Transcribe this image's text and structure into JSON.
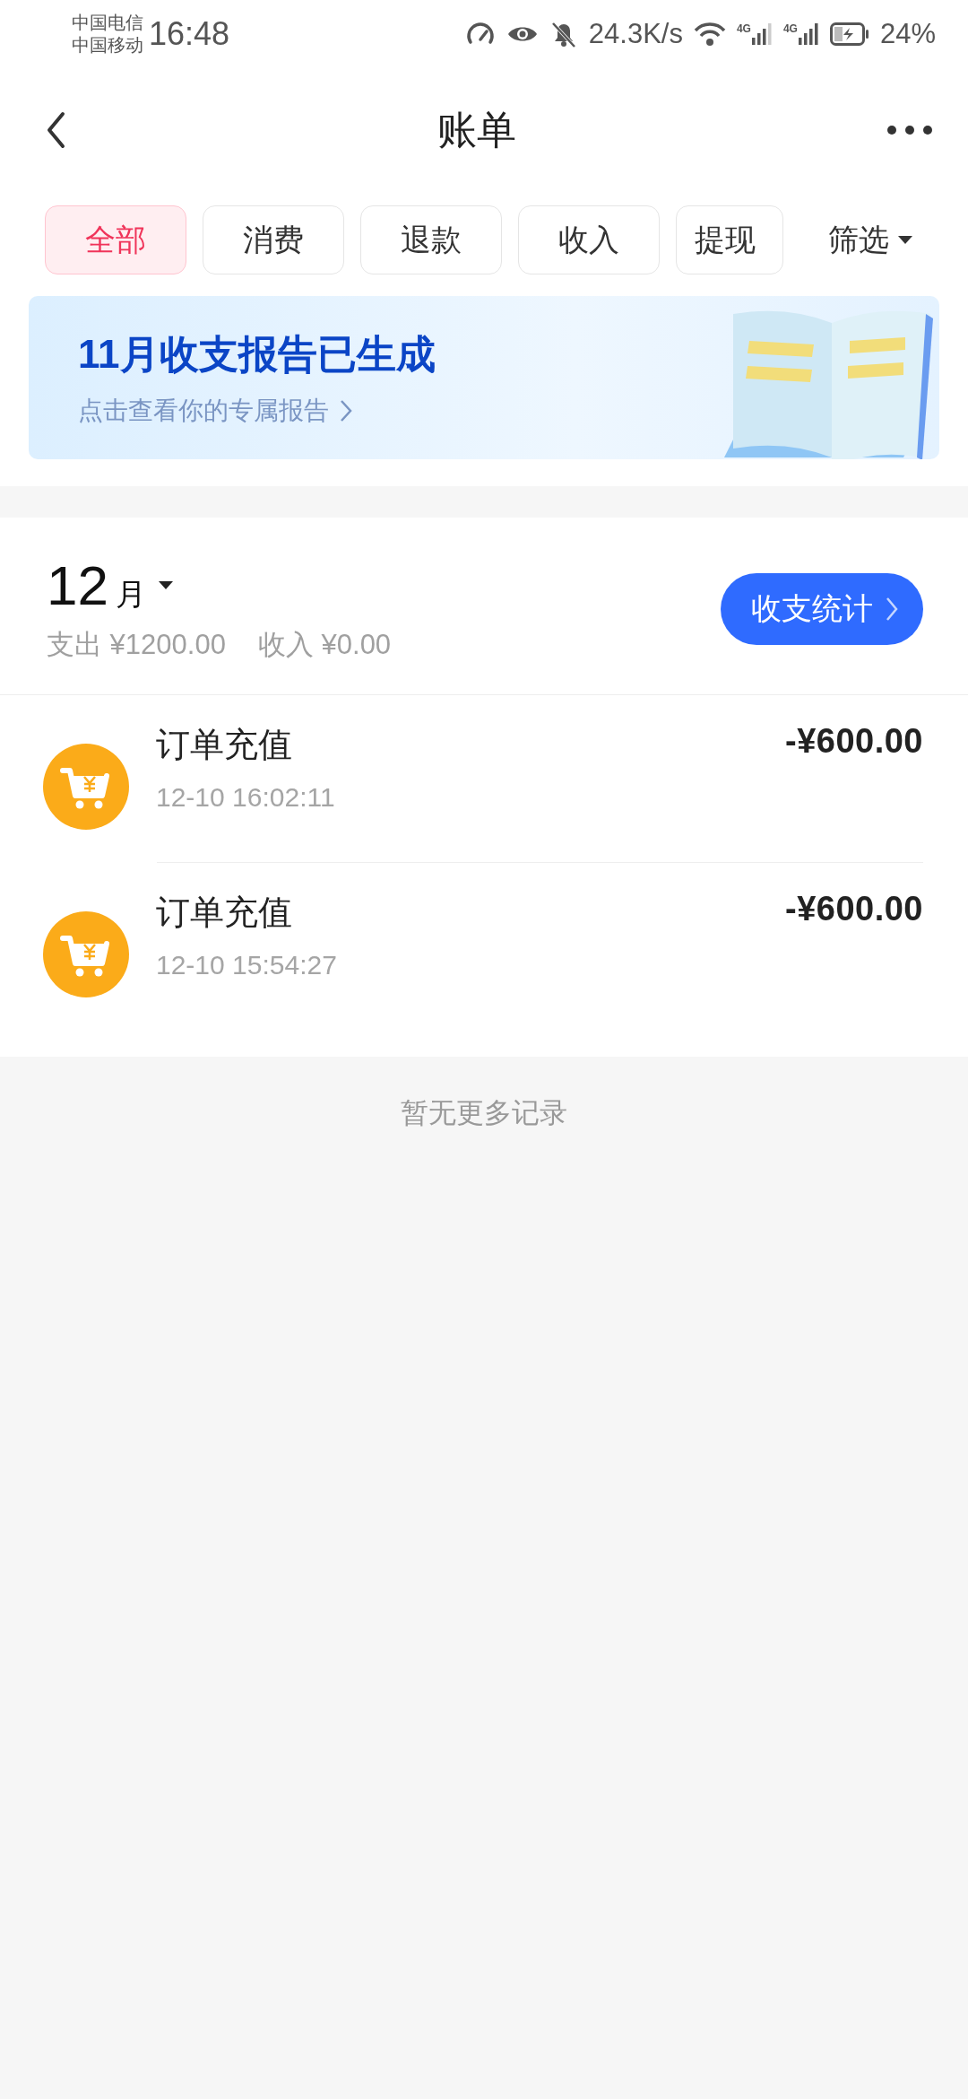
{
  "status_bar": {
    "carriers": [
      "中国电信",
      "中国移动"
    ],
    "time": "16:48",
    "net_speed": "24.3K/s",
    "signal_labels": [
      "4G",
      "4G"
    ],
    "battery": "24%"
  },
  "nav": {
    "title": "账单"
  },
  "tabs": [
    {
      "label": "全部",
      "selected": true
    },
    {
      "label": "消费",
      "selected": false
    },
    {
      "label": "退款",
      "selected": false
    },
    {
      "label": "收入",
      "selected": false
    },
    {
      "label": "提现",
      "selected": false
    }
  ],
  "filter": {
    "label": "筛选"
  },
  "banner": {
    "title": "11月收支报告已生成",
    "subtitle": "点击查看你的专属报告"
  },
  "summary": {
    "month": "12",
    "month_unit": "月",
    "expense": "支出 ¥1200.00",
    "income": "收入 ¥0.00",
    "stats_button": "收支统计"
  },
  "bills": [
    {
      "title": "订单充值",
      "time": "12-10 16:02:11",
      "amount": "-¥600.00"
    },
    {
      "title": "订单充值",
      "time": "12-10 15:54:27",
      "amount": "-¥600.00"
    }
  ],
  "footer": "暂无更多记录"
}
